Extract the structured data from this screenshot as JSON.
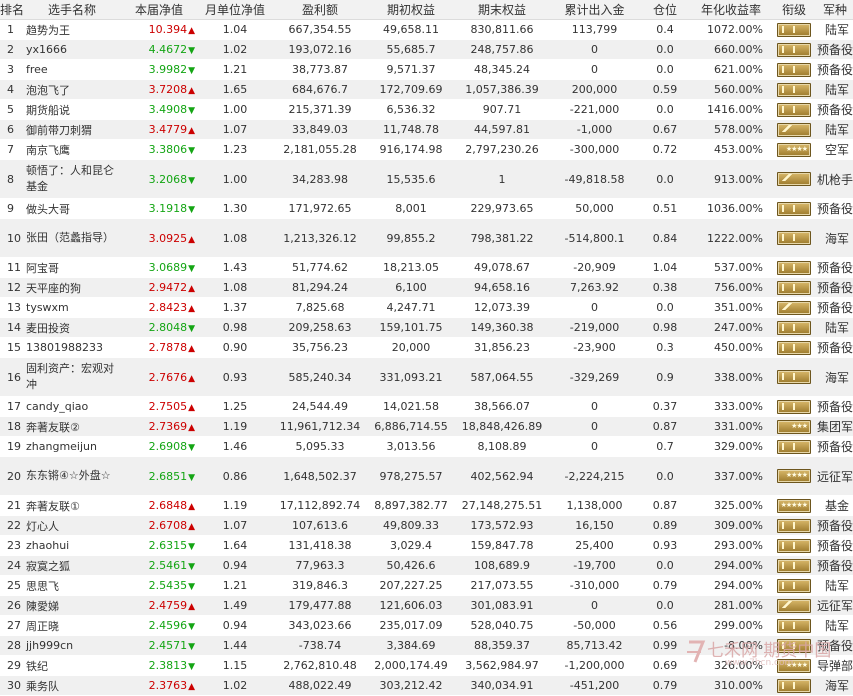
{
  "headers": {
    "rank": "排名",
    "name": "选手名称",
    "nav": "本届净值",
    "unit_nav": "月单位净值",
    "profit": "盈利额",
    "start_equity": "期初权益",
    "end_equity": "期末权益",
    "net_inflow": "累计出入金",
    "position": "仓位",
    "annual_return": "年化收益率",
    "rank_badge": "衔级",
    "army": "军种"
  },
  "colors": {
    "up": "#cc0000",
    "down": "#14a514",
    "badge_gold": "#c8a24a",
    "row_alt": "#f0f0f0"
  },
  "rows": [
    {
      "rank": "1",
      "name": "趋势为王",
      "nav": "10.394",
      "dir": "up",
      "unit_nav": "1.04",
      "profit": "667,354.55",
      "start_equity": "49,658.11",
      "end_equity": "830,811.66",
      "net_inflow": "113,799",
      "position": "0.4",
      "annual_return": "1072.00%",
      "badge": "bars-2",
      "army": "陆军",
      "tall": false
    },
    {
      "rank": "2",
      "name": "yx1666",
      "nav": "4.4672",
      "dir": "down",
      "unit_nav": "1.02",
      "profit": "193,072.16",
      "start_equity": "55,685.7",
      "end_equity": "248,757.86",
      "net_inflow": "0",
      "position": "0.0",
      "annual_return": "660.00%",
      "badge": "bars-2",
      "army": "预备役",
      "tall": false
    },
    {
      "rank": "3",
      "name": "free",
      "nav": "3.9982",
      "dir": "down",
      "unit_nav": "1.21",
      "profit": "38,773.87",
      "start_equity": "9,571.37",
      "end_equity": "48,345.24",
      "net_inflow": "0",
      "position": "0.0",
      "annual_return": "621.00%",
      "badge": "bars-1",
      "army": "预备役",
      "tall": false
    },
    {
      "rank": "4",
      "name": "泡泡飞了",
      "nav": "3.7208",
      "dir": "up",
      "unit_nav": "1.65",
      "profit": "684,676.7",
      "start_equity": "172,709.69",
      "end_equity": "1,057,386.39",
      "net_inflow": "200,000",
      "position": "0.59",
      "annual_return": "560.00%",
      "badge": "bars-3",
      "army": "陆军",
      "tall": false
    },
    {
      "rank": "5",
      "name": "期货船说",
      "nav": "3.4908",
      "dir": "down",
      "unit_nav": "1.00",
      "profit": "215,371.39",
      "start_equity": "6,536.32",
      "end_equity": "907.71",
      "net_inflow": "-221,000",
      "position": "0.0",
      "annual_return": "1416.00%",
      "badge": "bars-3",
      "army": "预备役",
      "tall": false
    },
    {
      "rank": "6",
      "name": "御前带刀刺猬",
      "nav": "3.4779",
      "dir": "up",
      "unit_nav": "1.07",
      "profit": "33,849.03",
      "start_equity": "11,748.78",
      "end_equity": "44,597.81",
      "net_inflow": "-1,000",
      "position": "0.67",
      "annual_return": "578.00%",
      "badge": "chev",
      "army": "陆军",
      "tall": false
    },
    {
      "rank": "7",
      "name": "南京飞鹰",
      "nav": "3.3806",
      "dir": "down",
      "unit_nav": "1.23",
      "profit": "2,181,055.28",
      "start_equity": "916,174.98",
      "end_equity": "2,797,230.26",
      "net_inflow": "-300,000",
      "position": "0.72",
      "annual_return": "453.00%",
      "badge": "stars-4",
      "army": "空军",
      "tall": false
    },
    {
      "rank": "8",
      "name": "顿悟了：人和昆仑基金",
      "nav": "3.2068",
      "dir": "down",
      "unit_nav": "1.00",
      "profit": "34,283.98",
      "start_equity": "15,535.6",
      "end_equity": "1",
      "net_inflow": "-49,818.58",
      "position": "0.0",
      "annual_return": "913.00%",
      "badge": "chev",
      "army": "机枪手",
      "tall": true
    },
    {
      "rank": "9",
      "name": "做头大哥",
      "nav": "3.1918",
      "dir": "down",
      "unit_nav": "1.30",
      "profit": "171,972.65",
      "start_equity": "8,001",
      "end_equity": "229,973.65",
      "net_inflow": "50,000",
      "position": "0.51",
      "annual_return": "1036.00%",
      "badge": "bars-2",
      "army": "预备役",
      "tall": false
    },
    {
      "rank": "10",
      "name": "张田（范蠡指导）",
      "nav": "3.0925",
      "dir": "up",
      "unit_nav": "1.08",
      "profit": "1,213,326.12",
      "start_equity": "99,855.2",
      "end_equity": "798,381.22",
      "net_inflow": "-514,800.1",
      "position": "0.84",
      "annual_return": "1222.00%",
      "badge": "bars-3",
      "army": "海军",
      "tall": true
    },
    {
      "rank": "11",
      "name": "阿宝哥",
      "nav": "3.0689",
      "dir": "down",
      "unit_nav": "1.43",
      "profit": "51,774.62",
      "start_equity": "18,213.05",
      "end_equity": "49,078.67",
      "net_inflow": "-20,909",
      "position": "1.04",
      "annual_return": "537.00%",
      "badge": "bars-2",
      "army": "预备役",
      "tall": false
    },
    {
      "rank": "12",
      "name": "天平座的狗",
      "nav": "2.9472",
      "dir": "up",
      "unit_nav": "1.08",
      "profit": "81,294.24",
      "start_equity": "6,100",
      "end_equity": "94,658.16",
      "net_inflow": "7,263.92",
      "position": "0.38",
      "annual_return": "756.00%",
      "badge": "bars-2",
      "army": "预备役",
      "tall": false
    },
    {
      "rank": "13",
      "name": "tyswxm",
      "nav": "2.8423",
      "dir": "up",
      "unit_nav": "1.37",
      "profit": "7,825.68",
      "start_equity": "4,247.71",
      "end_equity": "12,073.39",
      "net_inflow": "0",
      "position": "0.0",
      "annual_return": "351.00%",
      "badge": "chev",
      "army": "预备役",
      "tall": false
    },
    {
      "rank": "14",
      "name": "麦田投资",
      "nav": "2.8048",
      "dir": "down",
      "unit_nav": "0.98",
      "profit": "209,258.63",
      "start_equity": "159,101.75",
      "end_equity": "149,360.38",
      "net_inflow": "-219,000",
      "position": "0.98",
      "annual_return": "247.00%",
      "badge": "bars-2",
      "army": "陆军",
      "tall": false
    },
    {
      "rank": "15",
      "name": "13801988233",
      "nav": "2.7878",
      "dir": "up",
      "unit_nav": "0.90",
      "profit": "35,756.23",
      "start_equity": "20,000",
      "end_equity": "31,856.23",
      "net_inflow": "-23,900",
      "position": "0.3",
      "annual_return": "450.00%",
      "badge": "bars-2",
      "army": "预备役",
      "tall": false
    },
    {
      "rank": "16",
      "name": "固利资产：宏观对冲",
      "nav": "2.7676",
      "dir": "up",
      "unit_nav": "0.93",
      "profit": "585,240.34",
      "start_equity": "331,093.21",
      "end_equity": "587,064.55",
      "net_inflow": "-329,269",
      "position": "0.9",
      "annual_return": "338.00%",
      "badge": "bars-3",
      "army": "海军",
      "tall": true
    },
    {
      "rank": "17",
      "name": "candy_qiao",
      "nav": "2.7505",
      "dir": "up",
      "unit_nav": "1.25",
      "profit": "24,544.49",
      "start_equity": "14,021.58",
      "end_equity": "38,566.07",
      "net_inflow": "0",
      "position": "0.37",
      "annual_return": "333.00%",
      "badge": "bars-2",
      "army": "预备役",
      "tall": false
    },
    {
      "rank": "18",
      "name": "奔著友联②",
      "nav": "2.7369",
      "dir": "up",
      "unit_nav": "1.19",
      "profit": "11,961,712.34",
      "start_equity": "6,886,714.55",
      "end_equity": "18,848,426.89",
      "net_inflow": "0",
      "position": "0.87",
      "annual_return": "331.00%",
      "badge": "stars-3",
      "army": "集团军",
      "tall": false
    },
    {
      "rank": "19",
      "name": "zhangmeijun",
      "nav": "2.6908",
      "dir": "down",
      "unit_nav": "1.46",
      "profit": "5,095.33",
      "start_equity": "3,013.56",
      "end_equity": "8,108.89",
      "net_inflow": "0",
      "position": "0.7",
      "annual_return": "329.00%",
      "badge": "bars-2",
      "army": "预备役",
      "tall": false
    },
    {
      "rank": "20",
      "name": "东东锵④☆外盘☆",
      "nav": "2.6851",
      "dir": "down",
      "unit_nav": "0.86",
      "profit": "1,648,502.37",
      "start_equity": "978,275.57",
      "end_equity": "402,562.94",
      "net_inflow": "-2,224,215",
      "position": "0.0",
      "annual_return": "337.00%",
      "badge": "stars-4",
      "army": "远征军",
      "tall": true
    },
    {
      "rank": "21",
      "name": "奔著友联①",
      "nav": "2.6848",
      "dir": "up",
      "unit_nav": "1.19",
      "profit": "17,112,892.74",
      "start_equity": "8,897,382.77",
      "end_equity": "27,148,275.51",
      "net_inflow": "1,138,000",
      "position": "0.87",
      "annual_return": "325.00%",
      "badge": "stars-5",
      "army": "基金",
      "tall": false
    },
    {
      "rank": "22",
      "name": "灯心人",
      "nav": "2.6708",
      "dir": "up",
      "unit_nav": "1.07",
      "profit": "107,613.6",
      "start_equity": "49,809.33",
      "end_equity": "173,572.93",
      "net_inflow": "16,150",
      "position": "0.89",
      "annual_return": "309.00%",
      "badge": "bars-2",
      "army": "预备役",
      "tall": false
    },
    {
      "rank": "23",
      "name": "zhaohui",
      "nav": "2.6315",
      "dir": "down",
      "unit_nav": "1.64",
      "profit": "131,418.38",
      "start_equity": "3,029.4",
      "end_equity": "159,847.78",
      "net_inflow": "25,400",
      "position": "0.93",
      "annual_return": "293.00%",
      "badge": "bars-2",
      "army": "预备役",
      "tall": false
    },
    {
      "rank": "24",
      "name": "寂寞之狐",
      "nav": "2.5461",
      "dir": "down",
      "unit_nav": "0.94",
      "profit": "77,963.3",
      "start_equity": "50,426.6",
      "end_equity": "108,689.9",
      "net_inflow": "-19,700",
      "position": "0.0",
      "annual_return": "294.00%",
      "badge": "bars-2",
      "army": "预备役",
      "tall": false
    },
    {
      "rank": "25",
      "name": "思思飞",
      "nav": "2.5435",
      "dir": "down",
      "unit_nav": "1.21",
      "profit": "319,846.3",
      "start_equity": "207,227.25",
      "end_equity": "217,073.55",
      "net_inflow": "-310,000",
      "position": "0.79",
      "annual_return": "294.00%",
      "badge": "bars-3",
      "army": "陆军",
      "tall": false
    },
    {
      "rank": "26",
      "name": "陳愛娣",
      "nav": "2.4759",
      "dir": "up",
      "unit_nav": "1.49",
      "profit": "179,477.88",
      "start_equity": "121,606.03",
      "end_equity": "301,083.91",
      "net_inflow": "0",
      "position": "0.0",
      "annual_return": "281.00%",
      "badge": "chev",
      "army": "远征军",
      "tall": false
    },
    {
      "rank": "27",
      "name": "周正晓",
      "nav": "2.4596",
      "dir": "down",
      "unit_nav": "0.94",
      "profit": "343,023.66",
      "start_equity": "235,017.09",
      "end_equity": "528,040.75",
      "net_inflow": "-50,000",
      "position": "0.56",
      "annual_return": "299.00%",
      "badge": "bars-3",
      "army": "陆军",
      "tall": false
    },
    {
      "rank": "28",
      "name": "jjh999cn",
      "nav": "2.4571",
      "dir": "down",
      "unit_nav": "1.44",
      "profit": "-738.74",
      "start_equity": "3,384.69",
      "end_equity": "88,359.37",
      "net_inflow": "85,713.42",
      "position": "0.99",
      "annual_return": "-8.00%",
      "badge": "bars-2",
      "army": "预备役",
      "tall": false
    },
    {
      "rank": "29",
      "name": "铁纪",
      "nav": "2.3813",
      "dir": "down",
      "unit_nav": "1.15",
      "profit": "2,762,810.48",
      "start_equity": "2,000,174.49",
      "end_equity": "3,562,984.97",
      "net_inflow": "-1,200,000",
      "position": "0.69",
      "annual_return": "326.00%",
      "badge": "stars-4",
      "army": "导弹部",
      "tall": false
    },
    {
      "rank": "30",
      "name": "乘务队",
      "nav": "2.3763",
      "dir": "up",
      "unit_nav": "1.02",
      "profit": "488,022.49",
      "start_equity": "303,212.42",
      "end_equity": "340,034.91",
      "net_inflow": "-451,200",
      "position": "0.79",
      "annual_return": "310.00%",
      "badge": "bars-3",
      "army": "海军",
      "tall": false
    }
  ],
  "watermark": {
    "text": "七禾网 期货中国",
    "url": "www.7hcn.com"
  }
}
